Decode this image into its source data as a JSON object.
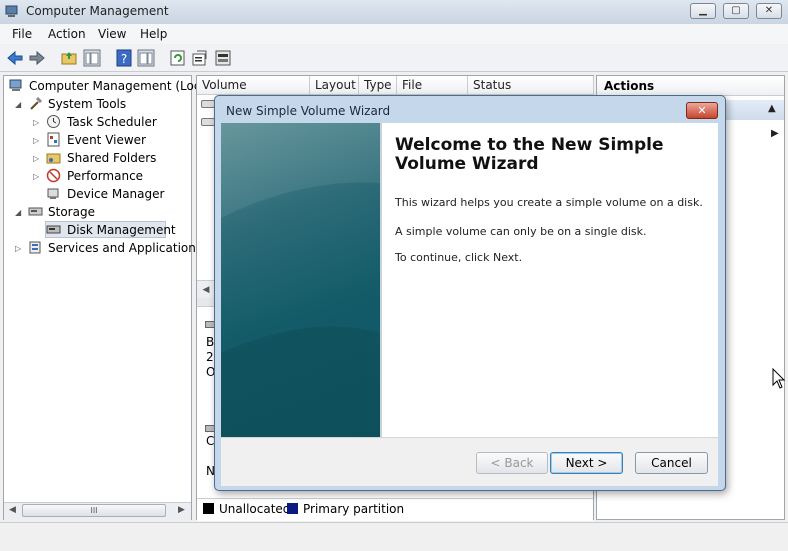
{
  "window": {
    "title": "Computer Management"
  },
  "menu": [
    "File",
    "Action",
    "View",
    "Help"
  ],
  "tree": {
    "root": "Computer Management (Local",
    "system_tools": "System Tools",
    "task_scheduler": "Task Scheduler",
    "event_viewer": "Event Viewer",
    "shared_folders": "Shared Folders",
    "performance": "Performance",
    "device_manager": "Device Manager",
    "storage": "Storage",
    "disk_management": "Disk Management",
    "services_apps": "Services and Applications",
    "scroll_label": "III"
  },
  "columns": [
    "Volume",
    "Layout",
    "Type",
    "File System",
    "Status"
  ],
  "middle": {
    "disk_b": "B",
    "disk_2": "2",
    "disk_o": "O",
    "disk_c": "C",
    "disk_n": "N"
  },
  "legend": {
    "unallocated": "Unallocated",
    "primary": "Primary partition"
  },
  "actions": {
    "header": "Actions"
  },
  "dialog": {
    "title": "New Simple Volume Wizard",
    "heading": "Welcome to the New Simple Volume Wizard",
    "p1": "This wizard helps you create a simple volume on a disk.",
    "p2": "A simple volume can only be on a single disk.",
    "p3": "To continue, click Next.",
    "back": "< Back",
    "next": "Next >",
    "cancel": "Cancel"
  },
  "colors": {
    "accent": "#135b68",
    "title_bar": "#c9d5e2",
    "close": "#c7452e"
  }
}
